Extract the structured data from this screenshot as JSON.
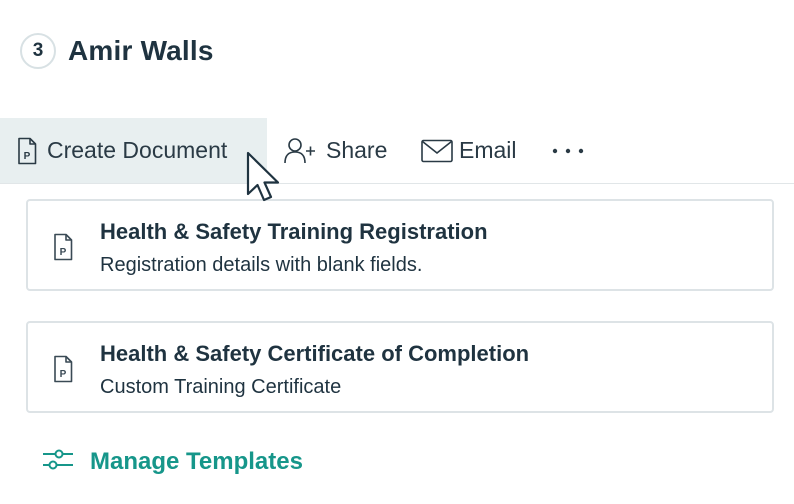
{
  "header": {
    "step": "3",
    "name": "Amir Walls"
  },
  "toolbar": {
    "create_label": "Create Document",
    "share_label": "Share",
    "email_label": "Email",
    "more_label": "···"
  },
  "templates": [
    {
      "title": "Health & Safety Training Registration",
      "subtitle": "Registration details with blank fields.",
      "icon": "document-p-icon"
    },
    {
      "title": "Health & Safety Certificate of Completion",
      "subtitle": "Custom Training Certificate",
      "icon": "document-p-icon"
    }
  ],
  "manage": {
    "label": "Manage Templates",
    "icon": "sliders-icon"
  },
  "colors": {
    "accent": "#16968a",
    "text": "#1f3340",
    "toolbar_active_bg": "#e8eff0",
    "border": "#dde3e6"
  }
}
